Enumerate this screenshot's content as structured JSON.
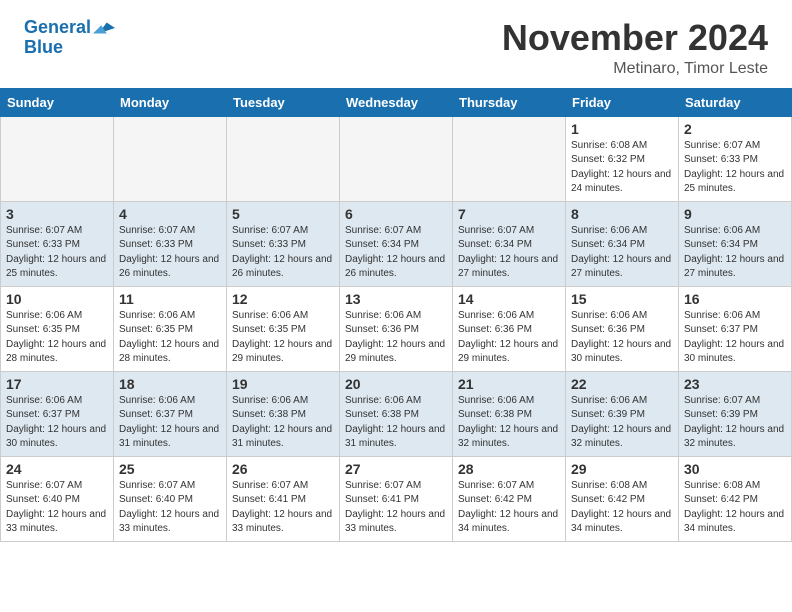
{
  "header": {
    "logo_line1": "General",
    "logo_line2": "Blue",
    "month": "November 2024",
    "location": "Metinaro, Timor Leste"
  },
  "days_of_week": [
    "Sunday",
    "Monday",
    "Tuesday",
    "Wednesday",
    "Thursday",
    "Friday",
    "Saturday"
  ],
  "weeks": [
    [
      {
        "day": "",
        "empty": true
      },
      {
        "day": "",
        "empty": true
      },
      {
        "day": "",
        "empty": true
      },
      {
        "day": "",
        "empty": true
      },
      {
        "day": "",
        "empty": true
      },
      {
        "day": "1",
        "sunrise": "6:08 AM",
        "sunset": "6:32 PM",
        "daylight": "12 hours and 24 minutes."
      },
      {
        "day": "2",
        "sunrise": "6:07 AM",
        "sunset": "6:33 PM",
        "daylight": "12 hours and 25 minutes."
      }
    ],
    [
      {
        "day": "3",
        "sunrise": "6:07 AM",
        "sunset": "6:33 PM",
        "daylight": "12 hours and 25 minutes."
      },
      {
        "day": "4",
        "sunrise": "6:07 AM",
        "sunset": "6:33 PM",
        "daylight": "12 hours and 26 minutes."
      },
      {
        "day": "5",
        "sunrise": "6:07 AM",
        "sunset": "6:33 PM",
        "daylight": "12 hours and 26 minutes."
      },
      {
        "day": "6",
        "sunrise": "6:07 AM",
        "sunset": "6:34 PM",
        "daylight": "12 hours and 26 minutes."
      },
      {
        "day": "7",
        "sunrise": "6:07 AM",
        "sunset": "6:34 PM",
        "daylight": "12 hours and 27 minutes."
      },
      {
        "day": "8",
        "sunrise": "6:06 AM",
        "sunset": "6:34 PM",
        "daylight": "12 hours and 27 minutes."
      },
      {
        "day": "9",
        "sunrise": "6:06 AM",
        "sunset": "6:34 PM",
        "daylight": "12 hours and 27 minutes."
      }
    ],
    [
      {
        "day": "10",
        "sunrise": "6:06 AM",
        "sunset": "6:35 PM",
        "daylight": "12 hours and 28 minutes."
      },
      {
        "day": "11",
        "sunrise": "6:06 AM",
        "sunset": "6:35 PM",
        "daylight": "12 hours and 28 minutes."
      },
      {
        "day": "12",
        "sunrise": "6:06 AM",
        "sunset": "6:35 PM",
        "daylight": "12 hours and 29 minutes."
      },
      {
        "day": "13",
        "sunrise": "6:06 AM",
        "sunset": "6:36 PM",
        "daylight": "12 hours and 29 minutes."
      },
      {
        "day": "14",
        "sunrise": "6:06 AM",
        "sunset": "6:36 PM",
        "daylight": "12 hours and 29 minutes."
      },
      {
        "day": "15",
        "sunrise": "6:06 AM",
        "sunset": "6:36 PM",
        "daylight": "12 hours and 30 minutes."
      },
      {
        "day": "16",
        "sunrise": "6:06 AM",
        "sunset": "6:37 PM",
        "daylight": "12 hours and 30 minutes."
      }
    ],
    [
      {
        "day": "17",
        "sunrise": "6:06 AM",
        "sunset": "6:37 PM",
        "daylight": "12 hours and 30 minutes."
      },
      {
        "day": "18",
        "sunrise": "6:06 AM",
        "sunset": "6:37 PM",
        "daylight": "12 hours and 31 minutes."
      },
      {
        "day": "19",
        "sunrise": "6:06 AM",
        "sunset": "6:38 PM",
        "daylight": "12 hours and 31 minutes."
      },
      {
        "day": "20",
        "sunrise": "6:06 AM",
        "sunset": "6:38 PM",
        "daylight": "12 hours and 31 minutes."
      },
      {
        "day": "21",
        "sunrise": "6:06 AM",
        "sunset": "6:38 PM",
        "daylight": "12 hours and 32 minutes."
      },
      {
        "day": "22",
        "sunrise": "6:06 AM",
        "sunset": "6:39 PM",
        "daylight": "12 hours and 32 minutes."
      },
      {
        "day": "23",
        "sunrise": "6:07 AM",
        "sunset": "6:39 PM",
        "daylight": "12 hours and 32 minutes."
      }
    ],
    [
      {
        "day": "24",
        "sunrise": "6:07 AM",
        "sunset": "6:40 PM",
        "daylight": "12 hours and 33 minutes."
      },
      {
        "day": "25",
        "sunrise": "6:07 AM",
        "sunset": "6:40 PM",
        "daylight": "12 hours and 33 minutes."
      },
      {
        "day": "26",
        "sunrise": "6:07 AM",
        "sunset": "6:41 PM",
        "daylight": "12 hours and 33 minutes."
      },
      {
        "day": "27",
        "sunrise": "6:07 AM",
        "sunset": "6:41 PM",
        "daylight": "12 hours and 33 minutes."
      },
      {
        "day": "28",
        "sunrise": "6:07 AM",
        "sunset": "6:42 PM",
        "daylight": "12 hours and 34 minutes."
      },
      {
        "day": "29",
        "sunrise": "6:08 AM",
        "sunset": "6:42 PM",
        "daylight": "12 hours and 34 minutes."
      },
      {
        "day": "30",
        "sunrise": "6:08 AM",
        "sunset": "6:42 PM",
        "daylight": "12 hours and 34 minutes."
      }
    ]
  ]
}
